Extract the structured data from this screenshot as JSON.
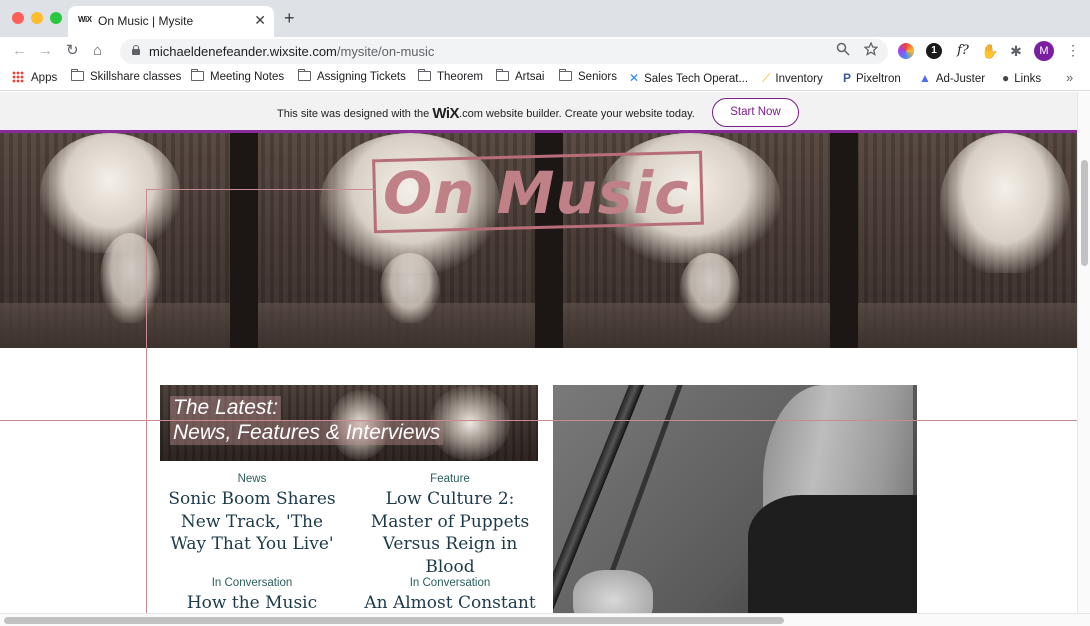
{
  "browser": {
    "tab": {
      "favicon": "WiX",
      "title": "On Music | Mysite",
      "close": "✕"
    },
    "new_tab": "+",
    "nav": {
      "back": "←",
      "forward": "→",
      "reload": "↻",
      "home": "⌂"
    },
    "url": {
      "host": "michaeldenefeander.wixsite.com",
      "path": "/mysite/on-music"
    },
    "icons": {
      "zoom": "zoom-icon",
      "star": "star-icon"
    },
    "extensions": {
      "ext2": "1",
      "ext3": "f?",
      "ext4": "✋",
      "ext5": "✱"
    },
    "avatar": "M",
    "menu": "⋮",
    "bookmarks": [
      {
        "label": "Apps",
        "icon": "apps-grid-icon"
      },
      {
        "label": "Skillshare classes",
        "icon": "folder-icon"
      },
      {
        "label": "Meeting Notes",
        "icon": "folder-icon"
      },
      {
        "label": "Assigning Tickets",
        "icon": "folder-icon"
      },
      {
        "label": "Theorem",
        "icon": "folder-icon"
      },
      {
        "label": "Artsai",
        "icon": "folder-icon"
      },
      {
        "label": "Seniors",
        "icon": "folder-icon"
      },
      {
        "label": "Sales Tech Operat...",
        "icon": "confluence-icon"
      },
      {
        "label": "Inventory",
        "icon": "inventory-icon"
      },
      {
        "label": "Pixeltron",
        "icon": "pixeltron-icon"
      },
      {
        "label": "Ad-Juster",
        "icon": "adjuster-icon"
      },
      {
        "label": "Links",
        "icon": "globe-icon"
      }
    ],
    "bookmarks_more": "»"
  },
  "wix_banner": {
    "text_before": "This site was designed with the ",
    "logo": "WiX",
    "logo_suffix": ".com",
    "text_after": " website builder. Create your website today.",
    "cta": "Start Now",
    "accent": "#7b1f8a"
  },
  "hero": {
    "title": "On Music",
    "title_color": "#c08088"
  },
  "latest": {
    "line1": "The Latest:",
    "line2": "News, Features & Interviews"
  },
  "articles": [
    {
      "category": "News",
      "headline": "Sonic Boom Shares New Track, 'The Way That You Live'"
    },
    {
      "category": "Feature",
      "headline": "Low Culture 2: Master of Puppets Versus Reign in Blood"
    },
    {
      "category": "In Conversation",
      "headline": "How the Music"
    },
    {
      "category": "In Conversation",
      "headline": "An Almost Constant"
    }
  ]
}
